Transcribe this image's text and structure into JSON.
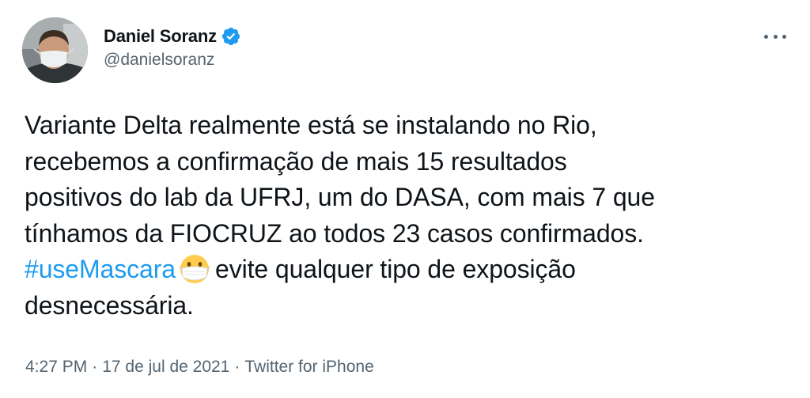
{
  "author": {
    "display_name": "Daniel Soranz",
    "handle": "@danielsoranz",
    "verified": true
  },
  "tweet": {
    "lines": [
      "Variante Delta realmente está se instalando no Rio,",
      "recebemos a confirmação de mais 15 resultados",
      "positivos do lab da UFRJ, um do DASA, com mais 7 que",
      "tínhamos da FIOCRUZ ao todos 23 casos confirmados."
    ],
    "hashtag": "#useMascara",
    "emoji": "face-with-medical-mask",
    "after_emoji": "evite qualquer tipo de exposição",
    "last_line": "desnecessária."
  },
  "meta": {
    "time": "4:27 PM",
    "date": "17 de jul de 2021",
    "source": "Twitter for iPhone",
    "separator": "·"
  },
  "colors": {
    "link": "#1d9bf0",
    "secondary": "#536471",
    "text": "#0f1419",
    "verified": "#1d9bf0"
  },
  "icons": {
    "verified": "verified-badge-icon",
    "more": "more-options-icon"
  }
}
